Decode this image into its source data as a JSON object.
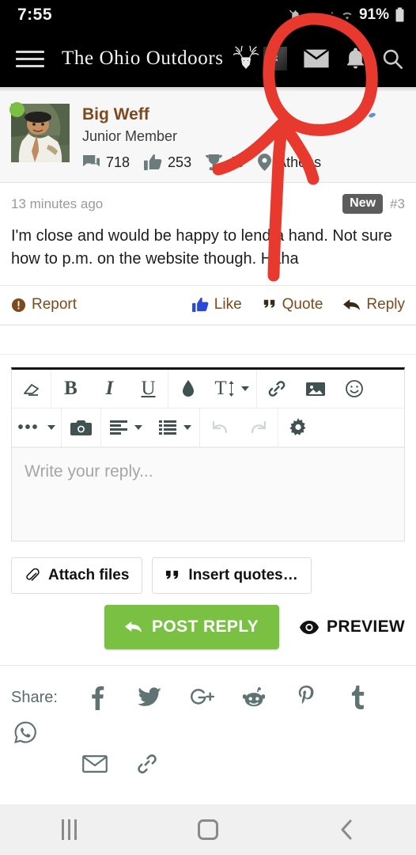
{
  "status_bar": {
    "time": "7:55",
    "battery_percent": "91%",
    "icons": [
      "alarm-mute-icon",
      "signal-icon",
      "data-transfer-icon",
      "wifi-icon",
      "battery-icon"
    ]
  },
  "header": {
    "menu_icon": "hamburger-menu-icon",
    "brand_title": "The Ohio Outdoors",
    "logo_icon": "deer-antler-skull-icon",
    "icons": [
      {
        "name": "user-badge-icon",
        "label": ""
      },
      {
        "name": "mail-icon",
        "label": ""
      },
      {
        "name": "bell-icon",
        "label": ""
      },
      {
        "name": "search-icon",
        "label": ""
      }
    ]
  },
  "post": {
    "username": "Big Weff",
    "user_title": "Junior Member",
    "online": true,
    "stats": [
      {
        "icon": "messages-icon",
        "value": "718"
      },
      {
        "icon": "thumbs-up-icon",
        "value": "253"
      },
      {
        "icon": "trophy-icon",
        "value": "46"
      },
      {
        "icon": "location-pin-icon",
        "value": "Athens"
      }
    ],
    "timestamp": "13 minutes ago",
    "new_badge": "New",
    "post_number": "#3",
    "body": "I'm close and would be happy to lend a hand. Not sure how to p.m. on the website though. Haha",
    "actions": {
      "report": "Report",
      "like": "Like",
      "quote": "Quote",
      "reply": "Reply"
    }
  },
  "editor": {
    "toolbar_row1": [
      {
        "name": "remove-formatting-icon",
        "label": ""
      },
      {
        "name": "bold-icon",
        "label": "B"
      },
      {
        "name": "italic-icon",
        "label": "I"
      },
      {
        "name": "underline-icon",
        "label": "U"
      },
      {
        "name": "text-color-icon",
        "label": ""
      },
      {
        "name": "font-size-icon",
        "label": "T"
      },
      {
        "name": "link-icon",
        "label": ""
      },
      {
        "name": "image-icon",
        "label": ""
      },
      {
        "name": "emoji-icon",
        "label": ""
      }
    ],
    "toolbar_row2": [
      {
        "name": "more-options-icon",
        "label": ""
      },
      {
        "name": "camera-icon",
        "label": ""
      },
      {
        "name": "text-align-icon",
        "label": ""
      },
      {
        "name": "list-icon",
        "label": ""
      },
      {
        "name": "undo-icon",
        "label": "",
        "disabled": true
      },
      {
        "name": "redo-icon",
        "label": "",
        "disabled": true
      },
      {
        "name": "settings-gear-icon",
        "label": ""
      }
    ],
    "reply_placeholder": "Write your reply...",
    "reply_value": "",
    "attach_files": "Attach files",
    "insert_quotes": "Insert quotes…",
    "post_reply": "POST REPLY",
    "preview": "PREVIEW"
  },
  "share": {
    "label": "Share:",
    "items": [
      {
        "name": "facebook-icon"
      },
      {
        "name": "twitter-icon"
      },
      {
        "name": "google-plus-icon"
      },
      {
        "name": "reddit-icon"
      },
      {
        "name": "pinterest-icon"
      },
      {
        "name": "tumblr-icon"
      },
      {
        "name": "whatsapp-icon"
      },
      {
        "name": "email-icon"
      },
      {
        "name": "link-icon"
      }
    ]
  },
  "nav_bar": {
    "recents": "recents-button",
    "home": "home-button",
    "back": "back-button"
  },
  "annotation": {
    "type": "hand-drawn-red-marker",
    "shapes": [
      "circle-around-mail-icon",
      "arrow-pointing-up-to-mail-icon"
    ],
    "color": "#e8392f"
  },
  "colors": {
    "brand_bar": "#000000",
    "username": "#7c4a1c",
    "action_link": "#7c4a1c",
    "post_button": "#7ac143",
    "online_dot": "#7bc043",
    "toolbar_icon": "#3f5251",
    "annotation_red": "#e8392f"
  }
}
